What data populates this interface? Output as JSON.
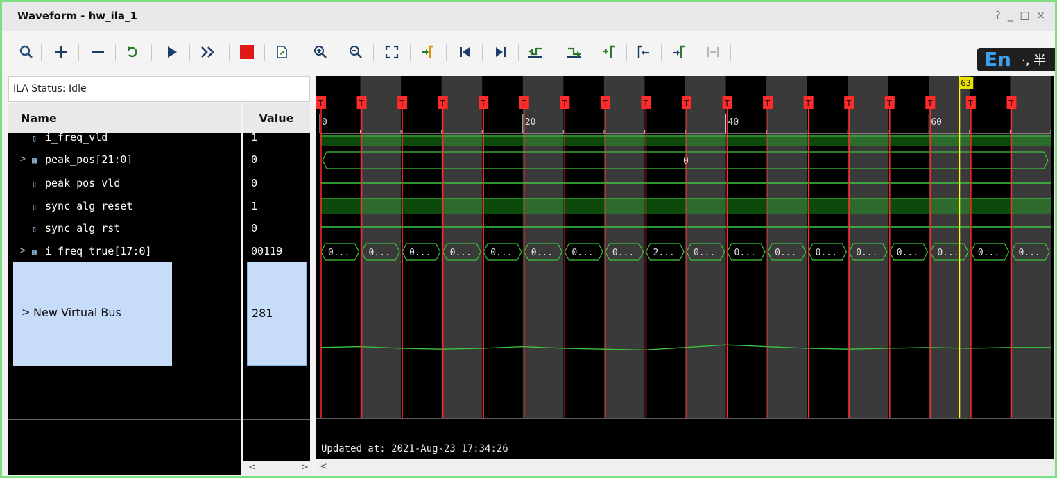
{
  "window": {
    "title": "Waveform - hw_ila_1",
    "controls": [
      "?",
      "_",
      "□",
      "×"
    ]
  },
  "toolbar": {
    "buttons": [
      "search-icon",
      "add-icon",
      "remove-icon",
      "refresh-icon",
      "play-icon",
      "fast-forward-icon",
      "stop-icon",
      "export-icon",
      "zoom-in-icon",
      "zoom-out-icon",
      "zoom-fit-icon",
      "go-to-cursor-icon",
      "go-to-start-icon",
      "go-to-end-icon",
      "previous-transition-icon",
      "next-transition-icon",
      "add-marker-icon",
      "previous-marker-icon",
      "next-marker-icon",
      "swap-cursors-icon"
    ]
  },
  "ime": {
    "lang": "En",
    "rest": "·, 半"
  },
  "ila_status": "ILA Status: Idle",
  "columns": {
    "name": "Name",
    "value": "Value"
  },
  "signals": [
    {
      "name": "i_freq_vld",
      "value": "1",
      "type": "bit",
      "expandable": false
    },
    {
      "name": "peak_pos[21:0]",
      "value": "0",
      "type": "bus",
      "expandable": true
    },
    {
      "name": "peak_pos_vld",
      "value": "0",
      "type": "bit",
      "expandable": false
    },
    {
      "name": "sync_alg_reset",
      "value": "1",
      "type": "bit",
      "expandable": false
    },
    {
      "name": "sync_alg_rst",
      "value": "0",
      "type": "bit",
      "expandable": false
    },
    {
      "name": "i_freq_true[17:0]",
      "value": "00119",
      "type": "bus",
      "expandable": true
    }
  ],
  "virtual_bus": {
    "name": "New Virtual Bus",
    "value": "281"
  },
  "timeline": {
    "start": 0,
    "end": 72,
    "ticks": [
      "0",
      "20",
      "40",
      "60"
    ],
    "tick_values": [
      0,
      20,
      40,
      60
    ],
    "trigger_label": "T",
    "trigger_count": 18,
    "cursor_label": "63",
    "cursor_value": 63
  },
  "peak_pos_bus_value": "0",
  "freq_true_bus_labels": [
    "0...",
    "0...",
    "0...",
    "0...",
    "0...",
    "0...",
    "0...",
    "0...",
    "2...",
    "0...",
    "0...",
    "0...",
    "0...",
    "0...",
    "0...",
    "0...",
    "0...",
    "0..."
  ],
  "analog_trace": [
    0.36,
    0.37,
    0.35,
    0.34,
    0.35,
    0.37,
    0.35,
    0.34,
    0.33,
    0.36,
    0.39,
    0.37,
    0.35,
    0.34,
    0.35,
    0.36,
    0.35,
    0.36,
    0.36
  ],
  "updated": "Updated at: 2021-Aug-23 17:34:26",
  "scroll": {
    "left": "<",
    "right": ">"
  },
  "colors": {
    "accent_border": "#7fde7f",
    "wave_green": "#2d6b2d",
    "wave_dark_green": "#0b4a0b",
    "trigger_red": "#ff2a2a",
    "cursor_yellow": "#ffff00",
    "selection_blue": "#c6dcf8"
  }
}
